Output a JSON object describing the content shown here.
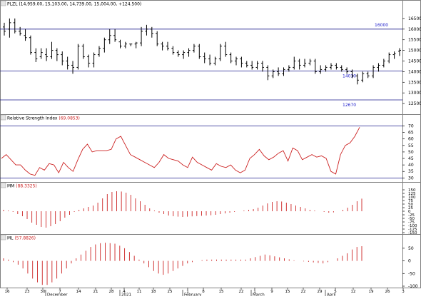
{
  "colors": {
    "background": "#ffffff",
    "border": "#808080",
    "frame": "#000000",
    "price_bar": "#000000",
    "level_line": "#1a1a8c",
    "level_label": "#2222cc",
    "indicator": "#cc2222",
    "header_bar": "#d8d8d8",
    "header_value": "#cc2222",
    "grid": "#c8c8c8"
  },
  "panels": [
    {
      "id": "price",
      "title": "PLZL",
      "title_value": "(14,959.00, 15,103.00, 14,739.00, 15,004.00, +124.500)"
    },
    {
      "id": "rsi",
      "title": "Relative Strength Index",
      "title_value": "(69.0853)"
    },
    {
      "id": "mm",
      "title": "MM",
      "title_value": "(88.3325)"
    },
    {
      "id": "ml",
      "title": "ML",
      "title_value": "(57.8826)"
    }
  ],
  "chart_data": [
    {
      "type": "candlestick",
      "panel": "price",
      "ylim": [
        12000,
        17000
      ],
      "y_ticks": [
        12500,
        13000,
        13500,
        14000,
        14500,
        15000,
        15500,
        16000,
        16500
      ],
      "ohlc": [
        [
          16100,
          16300,
          15700,
          15900
        ],
        [
          16000,
          16500,
          15600,
          16300
        ],
        [
          16300,
          16500,
          15800,
          15900
        ],
        [
          15900,
          16100,
          15700,
          15800
        ],
        [
          15700,
          16000,
          15450,
          15600
        ],
        [
          15600,
          15700,
          14800,
          14900
        ],
        [
          14900,
          15100,
          14450,
          14600
        ],
        [
          14700,
          15100,
          14600,
          14900
        ],
        [
          14800,
          15100,
          14500,
          14700
        ],
        [
          14700,
          15400,
          14600,
          15000
        ],
        [
          15000,
          15100,
          14500,
          14800
        ],
        [
          14800,
          14950,
          14300,
          14500
        ],
        [
          14500,
          14700,
          14100,
          14300
        ],
        [
          14300,
          14500,
          13900,
          14200
        ],
        [
          14200,
          15300,
          14100,
          15200
        ],
        [
          15200,
          15300,
          14600,
          14700
        ],
        [
          14700,
          14800,
          14200,
          14400
        ],
        [
          14400,
          14900,
          14200,
          14800
        ],
        [
          14800,
          15200,
          14700,
          15100
        ],
        [
          15100,
          15600,
          14900,
          15500
        ],
        [
          15500,
          16000,
          15300,
          15700
        ],
        [
          15700,
          16000,
          15400,
          15500
        ],
        [
          15400,
          15500,
          15100,
          15200
        ],
        [
          15200,
          15400,
          15100,
          15300
        ],
        [
          15300,
          15300,
          15200,
          15300
        ],
        [
          15300,
          15400,
          15100,
          15350
        ],
        [
          15350,
          16100,
          15200,
          15900
        ],
        [
          15900,
          16200,
          15700,
          16000
        ],
        [
          16000,
          16100,
          15600,
          15800
        ],
        [
          15800,
          15900,
          15200,
          15300
        ],
        [
          15300,
          15400,
          15000,
          15200
        ],
        [
          15200,
          15400,
          15000,
          15100
        ],
        [
          15100,
          15200,
          14800,
          14900
        ],
        [
          14900,
          15000,
          14700,
          14800
        ],
        [
          14800,
          15000,
          14600,
          14900
        ],
        [
          14900,
          15100,
          14700,
          15000
        ],
        [
          15000,
          15300,
          14900,
          15200
        ],
        [
          15200,
          15300,
          14600,
          14700
        ],
        [
          14700,
          14900,
          14400,
          14600
        ],
        [
          14600,
          14800,
          14300,
          14400
        ],
        [
          14400,
          14700,
          14300,
          14600
        ],
        [
          14600,
          15300,
          14500,
          15200
        ],
        [
          15200,
          15400,
          14700,
          14800
        ],
        [
          14800,
          14900,
          14400,
          14500
        ],
        [
          14500,
          14700,
          14300,
          14600
        ],
        [
          14600,
          14700,
          14200,
          14400
        ],
        [
          14400,
          14500,
          14200,
          14300
        ],
        [
          14300,
          14500,
          14100,
          14200
        ],
        [
          14200,
          14500,
          14100,
          14400
        ],
        [
          14400,
          14500,
          14000,
          14200
        ],
        [
          14200,
          14300,
          13600,
          13800
        ],
        [
          13800,
          14100,
          13700,
          14000
        ],
        [
          14000,
          14200,
          13800,
          13900
        ],
        [
          13900,
          14200,
          13800,
          14100
        ],
        [
          14100,
          14300,
          14000,
          14200
        ],
        [
          14200,
          14700,
          14100,
          14500
        ],
        [
          14500,
          14600,
          14100,
          14300
        ],
        [
          14300,
          14600,
          14200,
          14400
        ],
        [
          14400,
          14600,
          14300,
          14500
        ],
        [
          14500,
          14600,
          13900,
          14000
        ],
        [
          14000,
          14300,
          13900,
          14100
        ],
        [
          14100,
          14300,
          14000,
          14200
        ],
        [
          14200,
          14400,
          14100,
          14300
        ],
        [
          14300,
          14400,
          14100,
          14200
        ],
        [
          14200,
          14300,
          14000,
          14100
        ],
        [
          14100,
          14200,
          13900,
          14000
        ],
        [
          14000,
          14100,
          13700,
          13800
        ],
        [
          13800,
          13900,
          13400,
          13600
        ],
        [
          13600,
          14000,
          13500,
          13900
        ],
        [
          13900,
          14000,
          13700,
          13800
        ],
        [
          13800,
          14300,
          13700,
          14200
        ],
        [
          14200,
          14400,
          14000,
          14300
        ],
        [
          14300,
          14600,
          14200,
          14500
        ],
        [
          14500,
          14900,
          14400,
          14800
        ],
        [
          14800,
          14950,
          14600,
          14850
        ],
        [
          14959,
          15103,
          14739,
          15004
        ]
      ],
      "levels": [
        {
          "value": 16000,
          "label": "16000"
        },
        {
          "value": 14030,
          "label": "14030"
        },
        {
          "value": 12670,
          "label": "12670"
        }
      ]
    },
    {
      "type": "line",
      "panel": "rsi",
      "ylim": [
        28,
        73
      ],
      "y_ticks": [
        30,
        35,
        40,
        45,
        50,
        55,
        60,
        65,
        70
      ],
      "guides": [
        30,
        70
      ],
      "values": [
        45,
        48,
        44,
        40,
        40,
        36,
        33,
        32,
        38,
        36,
        41,
        40,
        34,
        42,
        38,
        35,
        44,
        52,
        56,
        50,
        51,
        51,
        51,
        52,
        60,
        62,
        55,
        48,
        46,
        44,
        42,
        40,
        38,
        42,
        48,
        45,
        44,
        43,
        40,
        38,
        46,
        42,
        40,
        38,
        36,
        41,
        39,
        38,
        40,
        36,
        34,
        36,
        45,
        48,
        52,
        47,
        44,
        46,
        49,
        51,
        43,
        53,
        51,
        44,
        46,
        48,
        46,
        47,
        45,
        35,
        33,
        48,
        55,
        57,
        62,
        69
      ],
      "hlines_dates": []
    },
    {
      "type": "bar",
      "panel": "mm",
      "ylim": [
        -150,
        150
      ],
      "y_ticks": [
        -150,
        -125,
        -100,
        -75,
        -50,
        -25,
        0,
        25,
        50,
        75,
        100,
        125,
        150
      ],
      "values": [
        10,
        5,
        -5,
        -20,
        -35,
        -55,
        -80,
        -95,
        -110,
        -115,
        -105,
        -90,
        -70,
        -45,
        -25,
        -5,
        10,
        20,
        30,
        40,
        60,
        90,
        120,
        135,
        140,
        138,
        130,
        115,
        90,
        70,
        45,
        20,
        5,
        -10,
        -20,
        -30,
        -35,
        -38,
        -40,
        -38,
        -36,
        -34,
        -32,
        -30,
        -28,
        -25,
        -20,
        -15,
        -10,
        -5,
        0,
        5,
        10,
        15,
        25,
        40,
        55,
        65,
        70,
        68,
        60,
        50,
        40,
        30,
        20,
        10,
        5,
        0,
        -5,
        -10,
        -8,
        0,
        10,
        25,
        45,
        70,
        88
      ]
    },
    {
      "type": "bar",
      "panel": "ml",
      "ylim": [
        -100,
        75
      ],
      "y_ticks": [
        -100,
        -50,
        0,
        50
      ],
      "values": [
        10,
        5,
        -5,
        -15,
        -30,
        -50,
        -70,
        -85,
        -95,
        -95,
        -85,
        -70,
        -50,
        -30,
        -10,
        10,
        25,
        40,
        55,
        65,
        70,
        72,
        70,
        68,
        60,
        50,
        35,
        20,
        5,
        -10,
        -25,
        -40,
        -50,
        -55,
        -50,
        -40,
        -30,
        -20,
        -10,
        -5,
        0,
        3,
        5,
        5,
        5,
        5,
        5,
        5,
        5,
        5,
        5,
        10,
        15,
        20,
        25,
        22,
        18,
        14,
        10,
        6,
        2,
        0,
        -2,
        -4,
        -6,
        -8,
        -10,
        -5,
        0,
        10,
        20,
        30,
        45,
        55,
        58
      ]
    }
  ],
  "x_axis": {
    "labels": [
      "16",
      "23",
      "30",
      "7",
      "14",
      "21",
      "28",
      "4",
      "11",
      "18",
      "25",
      "1",
      "8",
      "15",
      "22",
      "1",
      "9",
      "15",
      "22",
      "29",
      "5",
      "12",
      "19",
      "26",
      "3"
    ],
    "months": [
      "December",
      "2021",
      "February",
      "March",
      "April"
    ]
  }
}
